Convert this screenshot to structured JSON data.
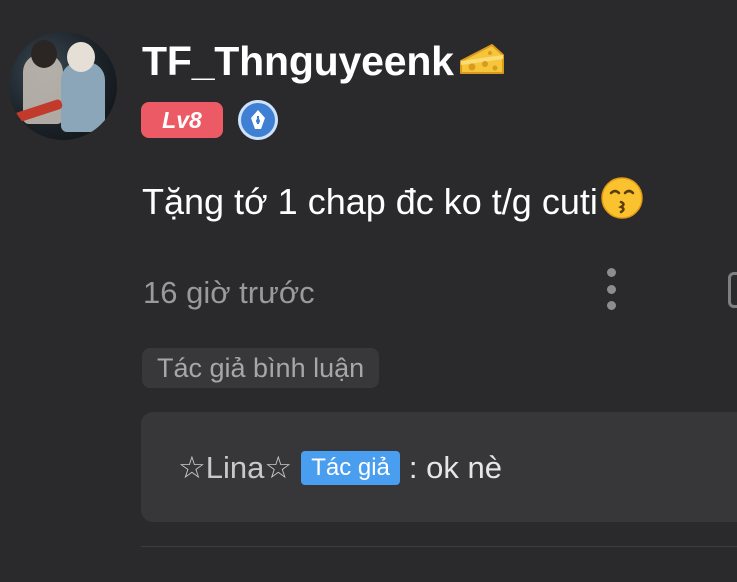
{
  "comment": {
    "username": "TF_Thnguyeenk",
    "username_icon": "cheese-icon",
    "level": "Lv8",
    "role_icon": "pen-nib-icon",
    "text": "Tặng tớ 1 chap đc ko t/g cuti",
    "text_emoji": "kissing-face-icon",
    "timestamp": "16 giờ trước",
    "more_icon": "more-vertical-icon",
    "author_label": "Tác giả bình luận"
  },
  "reply": {
    "name": "☆Lina☆",
    "tag": "Tác giả",
    "text": ": ok nè"
  },
  "colors": {
    "background": "#2a2a2c",
    "level_badge": "#ec5a66",
    "author_tag": "#4a9ef0",
    "muted_text": "#9a9a9c"
  }
}
